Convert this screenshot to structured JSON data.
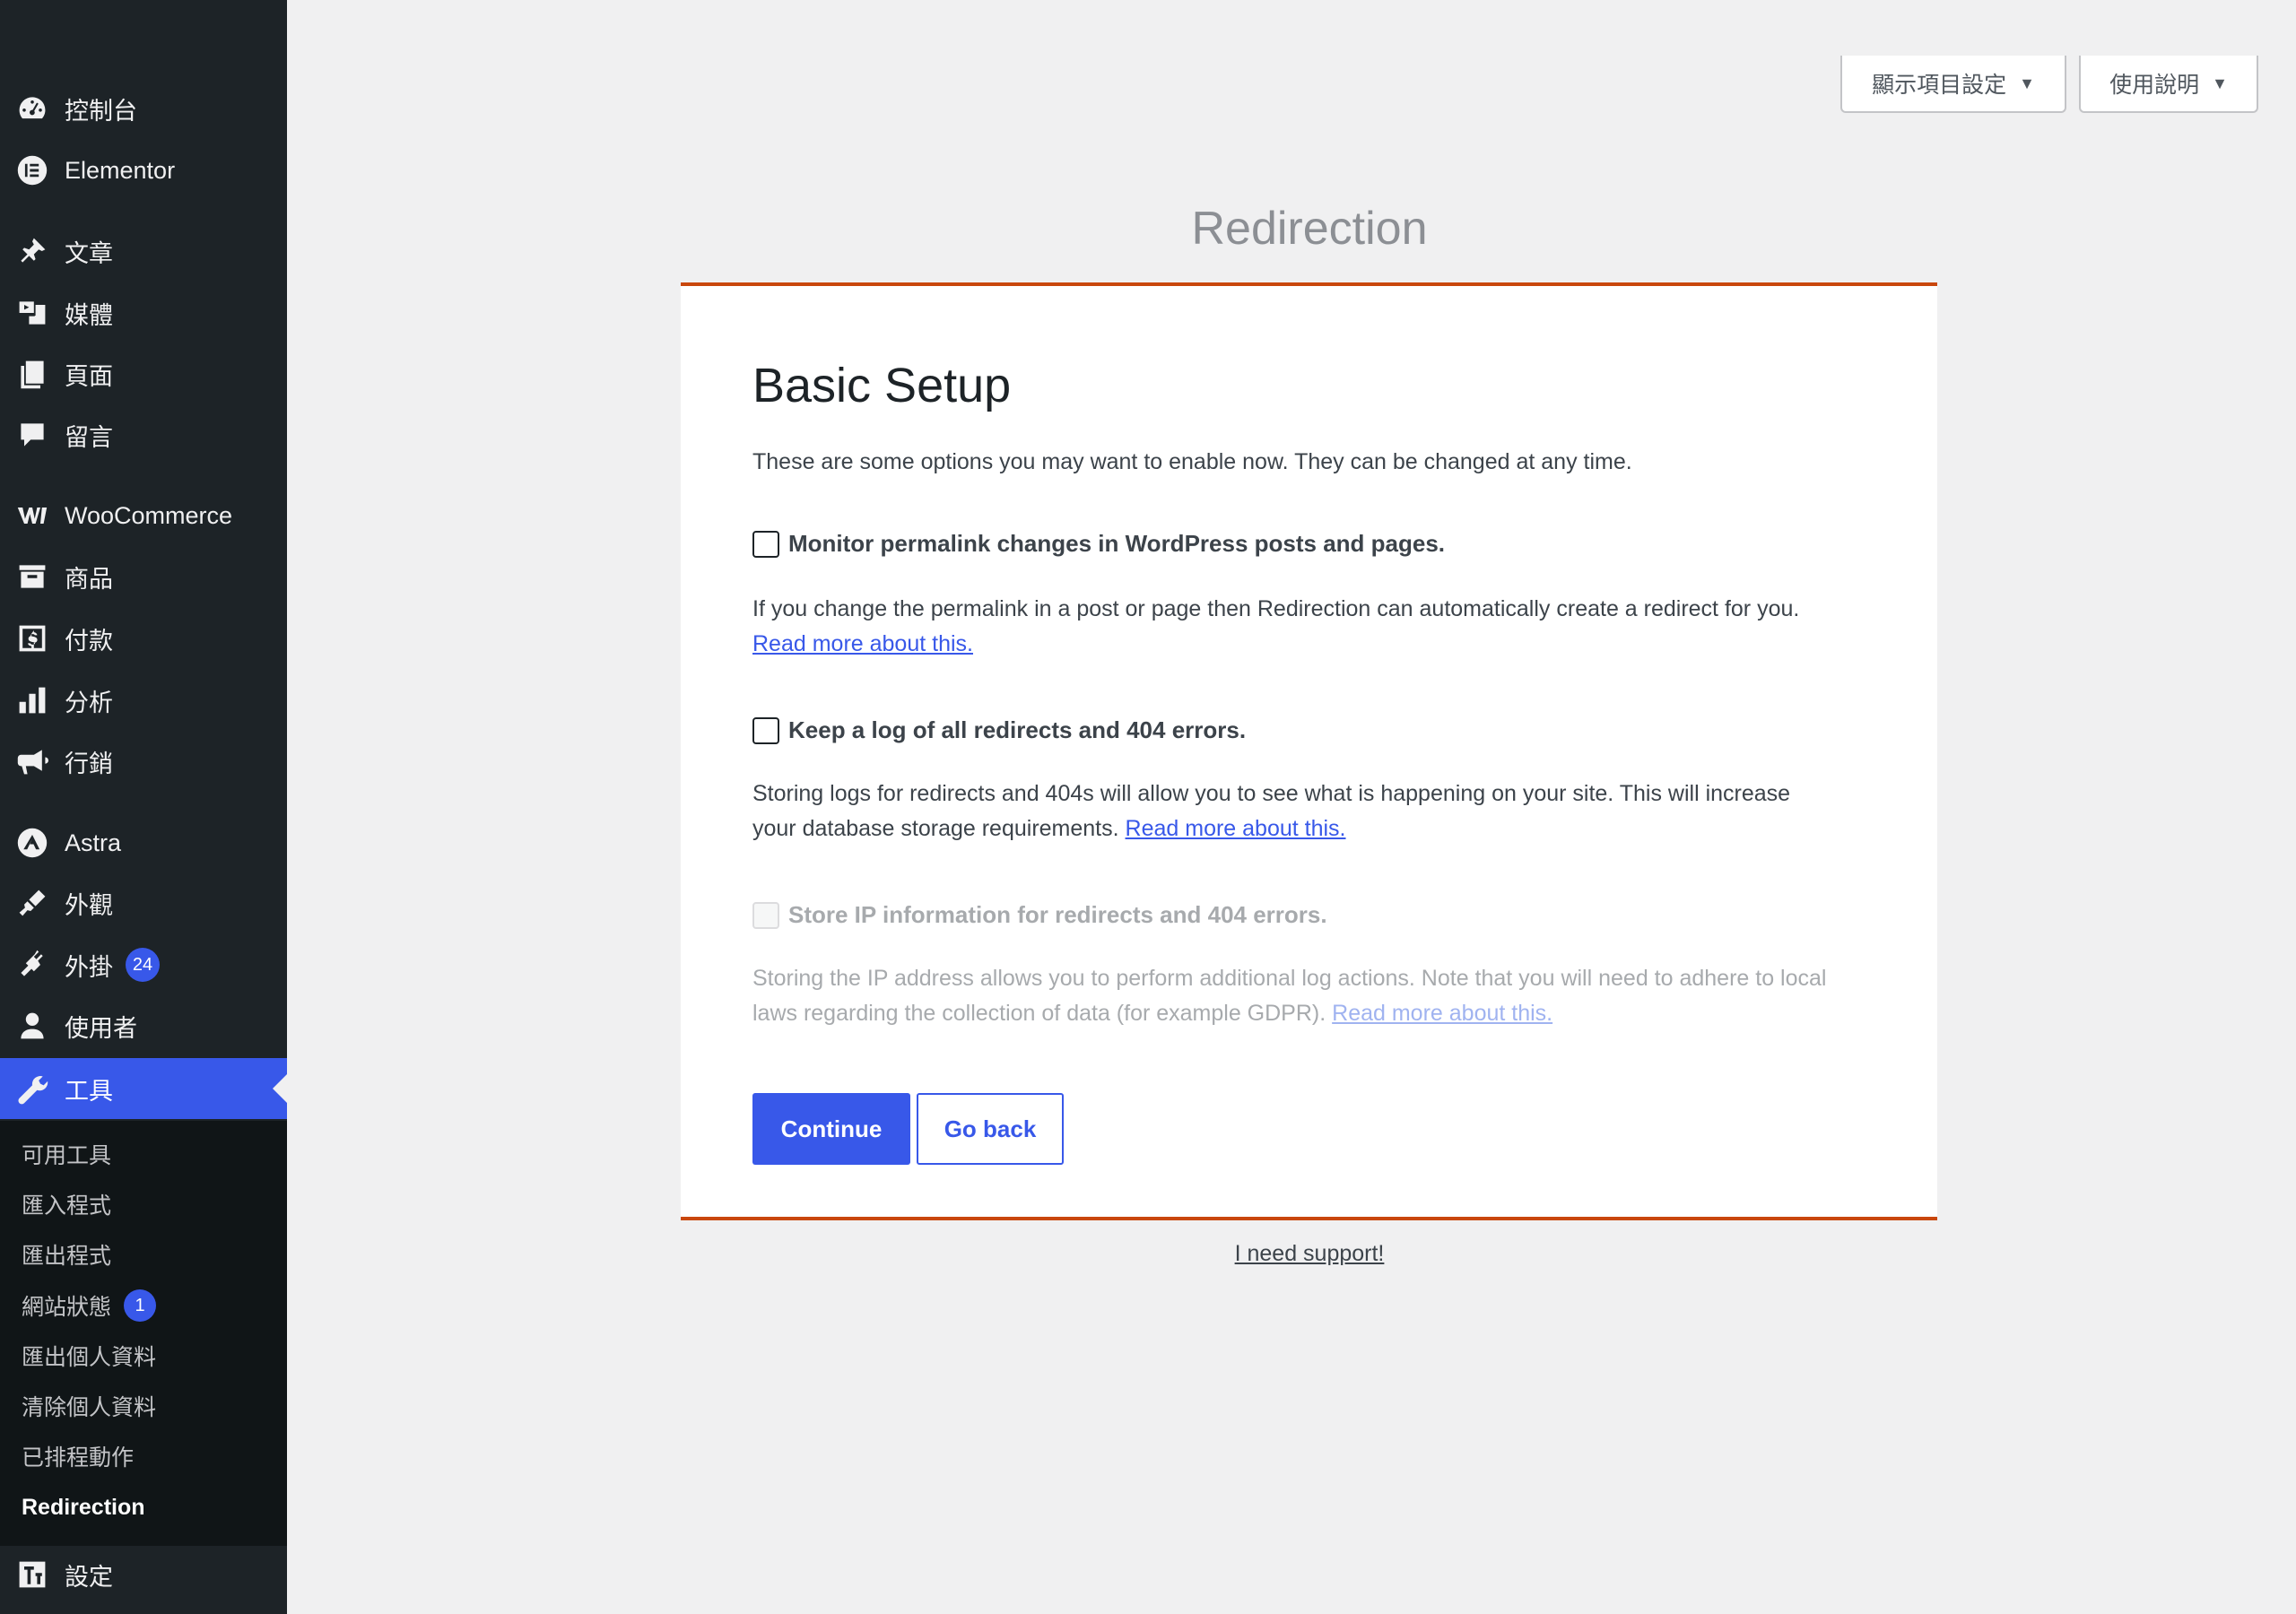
{
  "sidebar": {
    "items": [
      {
        "label": "控制台",
        "icon": "dashboard-icon"
      },
      {
        "label": "Elementor",
        "icon": "elementor-icon"
      },
      {
        "label": "文章",
        "icon": "pin-icon"
      },
      {
        "label": "媒體",
        "icon": "media-icon"
      },
      {
        "label": "頁面",
        "icon": "pages-icon"
      },
      {
        "label": "留言",
        "icon": "comment-icon"
      },
      {
        "label": "WooCommerce",
        "icon": "woocommerce-icon"
      },
      {
        "label": "商品",
        "icon": "archive-icon"
      },
      {
        "label": "付款",
        "icon": "payment-icon"
      },
      {
        "label": "分析",
        "icon": "chart-icon"
      },
      {
        "label": "行銷",
        "icon": "megaphone-icon"
      },
      {
        "label": "Astra",
        "icon": "astra-icon"
      },
      {
        "label": "外觀",
        "icon": "brush-icon"
      },
      {
        "label": "外掛",
        "icon": "plugin-icon",
        "badge": "24"
      },
      {
        "label": "使用者",
        "icon": "user-icon"
      },
      {
        "label": "工具",
        "icon": "wrench-icon"
      },
      {
        "label": "設定",
        "icon": "settings-icon"
      }
    ],
    "submenu": [
      {
        "label": "可用工具"
      },
      {
        "label": "匯入程式"
      },
      {
        "label": "匯出程式"
      },
      {
        "label": "網站狀態",
        "badge": "1"
      },
      {
        "label": "匯出個人資料"
      },
      {
        "label": "清除個人資料"
      },
      {
        "label": "已排程動作"
      },
      {
        "label": "Redirection"
      }
    ]
  },
  "header": {
    "screen_options": "顯示項目設定",
    "help": "使用說明"
  },
  "plugin_title": "Redirection",
  "setup": {
    "title": "Basic Setup",
    "intro": "These are some options you may want to enable now. They can be changed at any time.",
    "options": [
      {
        "label": "Monitor permalink changes in WordPress posts and pages.",
        "description": "If you change the permalink in a post or page then Redirection can automatically create a redirect for you.",
        "link": "Read more about this.",
        "checked": false,
        "disabled": false
      },
      {
        "label": "Keep a log of all redirects and 404 errors.",
        "description": "Storing logs for redirects and 404s will allow you to see what is happening on your site. This will increase your database storage requirements.",
        "link": "Read more about this.",
        "checked": false,
        "disabled": false
      },
      {
        "label": "Store IP information for redirects and 404 errors.",
        "description": "Storing the IP address allows you to perform additional log actions. Note that you will need to adhere to local laws regarding the collection of data (for example GDPR).",
        "link": "Read more about this.",
        "checked": false,
        "disabled": true
      }
    ],
    "continue": "Continue",
    "go_back": "Go back"
  },
  "support_link": "I need support!",
  "colors": {
    "accent": "#3858e9",
    "sidebar": "#1d2327",
    "panel_border": "#c9470d"
  }
}
